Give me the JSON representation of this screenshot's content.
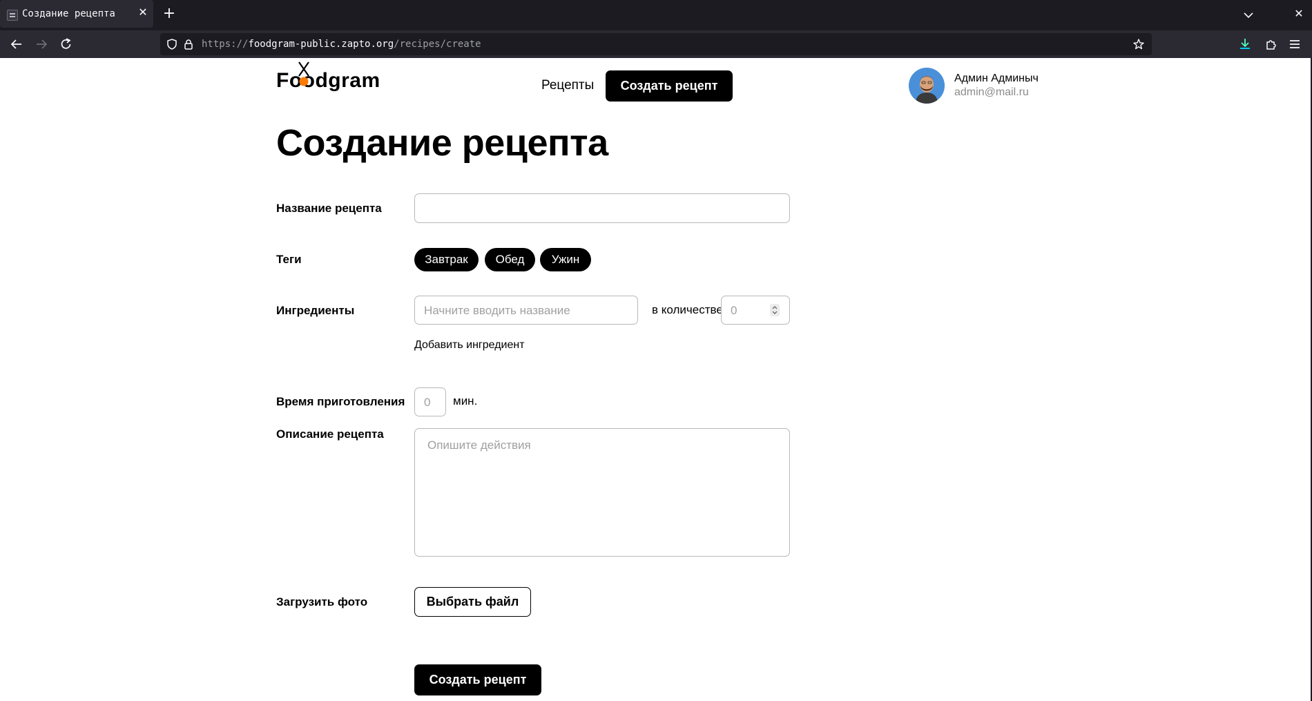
{
  "browser": {
    "tab_title": "Создание рецепта",
    "url_scheme": "https://",
    "url_host": "foodgram-public.zapto.org",
    "url_path": "/recipes/create"
  },
  "header": {
    "logo_text": "Foodgram",
    "nav_recipes": "Рецепты",
    "create_recipe_button": "Создать рецепт",
    "user_name": "Админ Админыч",
    "user_email": "admin@mail.ru"
  },
  "form": {
    "page_title": "Создание рецепта",
    "name_label": "Название рецепта",
    "name_value": "",
    "tags_label": "Теги",
    "tags": [
      "Завтрак",
      "Обед",
      "Ужин"
    ],
    "ingredients_label": "Ингредиенты",
    "ingredient_placeholder": "Начните вводить название",
    "quantity_label": "в количестве",
    "quantity_placeholder": "0",
    "add_ingredient": "Добавить ингредиент",
    "cooking_time_label": "Время приготовления",
    "cooking_time_placeholder": "0",
    "cooking_time_unit": "мин.",
    "description_label": "Описание рецепта",
    "description_placeholder": "Опишите действия",
    "photo_label": "Загрузить фото",
    "choose_file_button": "Выбрать файл",
    "submit_button": "Создать рецепт"
  },
  "colors": {
    "brand_accent": "#ff7a00",
    "button_bg": "#000000",
    "browser_chrome": "#2b2a33"
  }
}
